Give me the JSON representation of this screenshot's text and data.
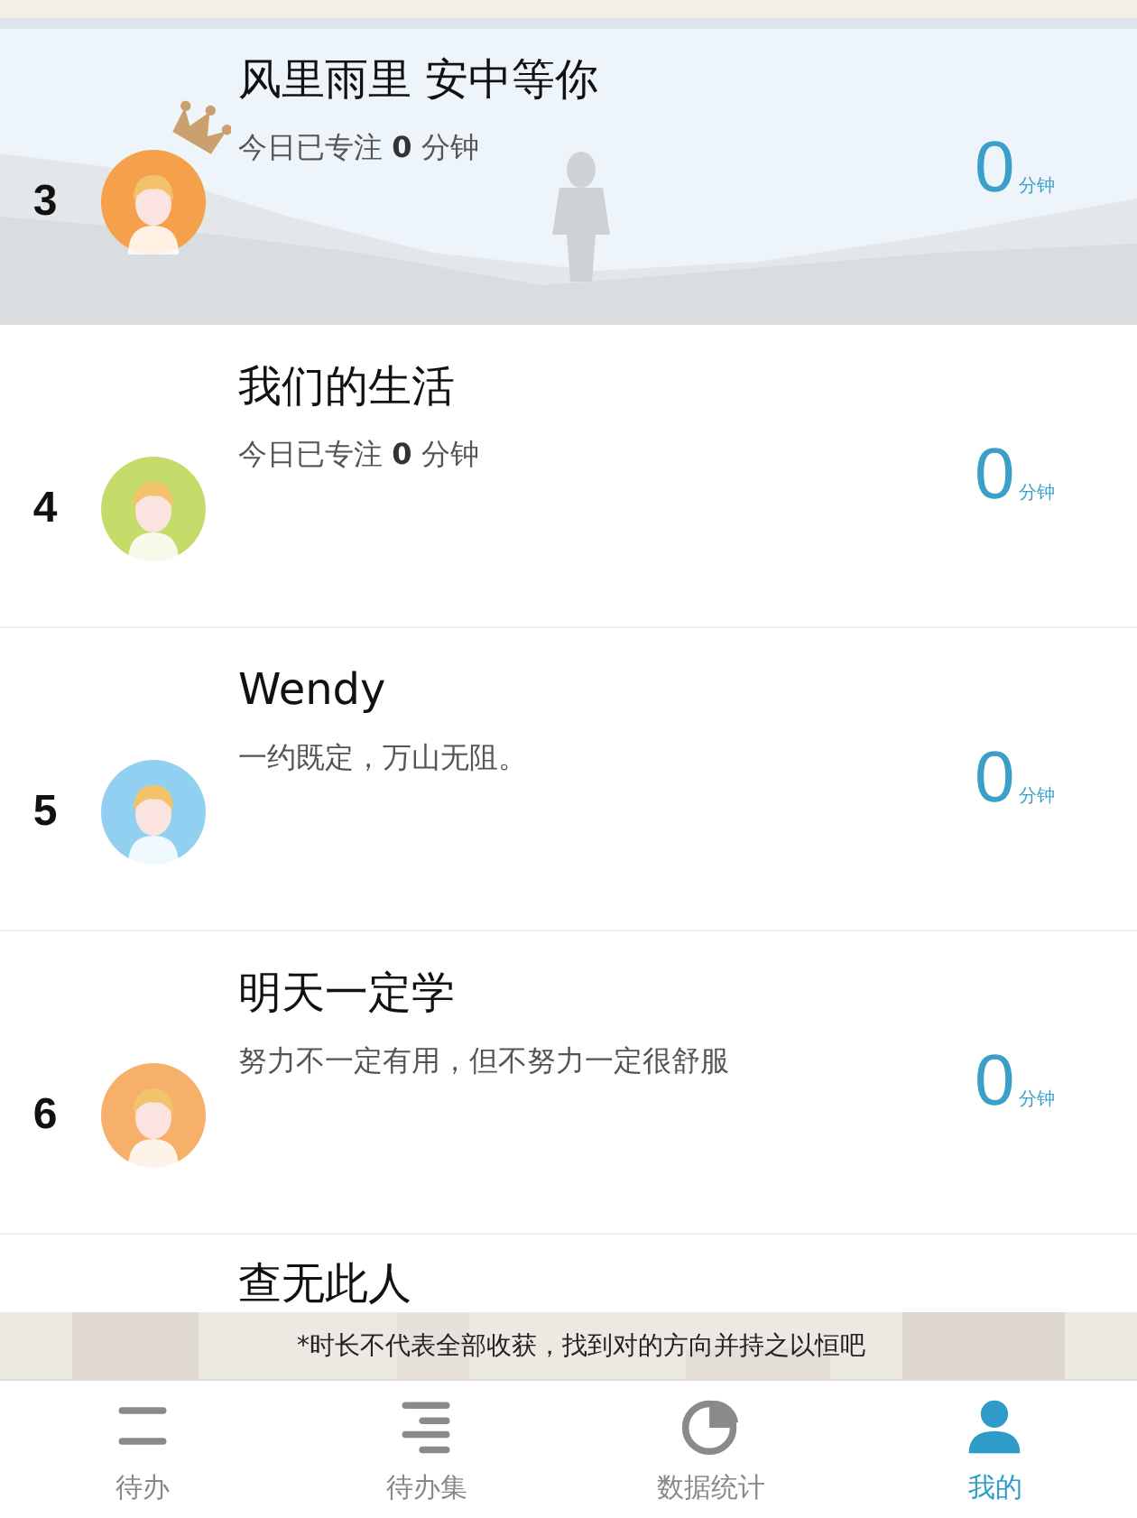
{
  "ranking": [
    {
      "rank": "3",
      "name": "风里雨里 安中等你",
      "subtitle": "今日已专注 **0** 分钟",
      "score": "0",
      "unit": "分钟",
      "color": "#f5a04a",
      "crown": true,
      "highlighted": true
    },
    {
      "rank": "4",
      "name": "我们的生活",
      "subtitle": "今日已专注 **0** 分钟",
      "score": "0",
      "unit": "分钟",
      "color": "#c5dc6a",
      "crown": false,
      "highlighted": false
    },
    {
      "rank": "5",
      "name": "Wendy",
      "subtitle": "一约既定，万山无阻。",
      "score": "0",
      "unit": "分钟",
      "color": "#92d0f2",
      "crown": false,
      "highlighted": false
    },
    {
      "rank": "6",
      "name": "明天一定学",
      "subtitle": "努力不一定有用，但不努力一定很舒服",
      "score": "0",
      "unit": "分钟",
      "color": "#f7b06a",
      "crown": false,
      "highlighted": false
    },
    {
      "name": "查无此人"
    }
  ],
  "note": "*时长不代表全部收获，找到对的方向并持之以恒吧",
  "tabs": [
    {
      "label": "待办",
      "kind": "bars",
      "selected": false
    },
    {
      "label": "待办集",
      "kind": "list",
      "selected": false
    },
    {
      "label": "数据统计",
      "kind": "pie",
      "selected": false
    },
    {
      "label": "我的",
      "kind": "person",
      "selected": true
    }
  ]
}
